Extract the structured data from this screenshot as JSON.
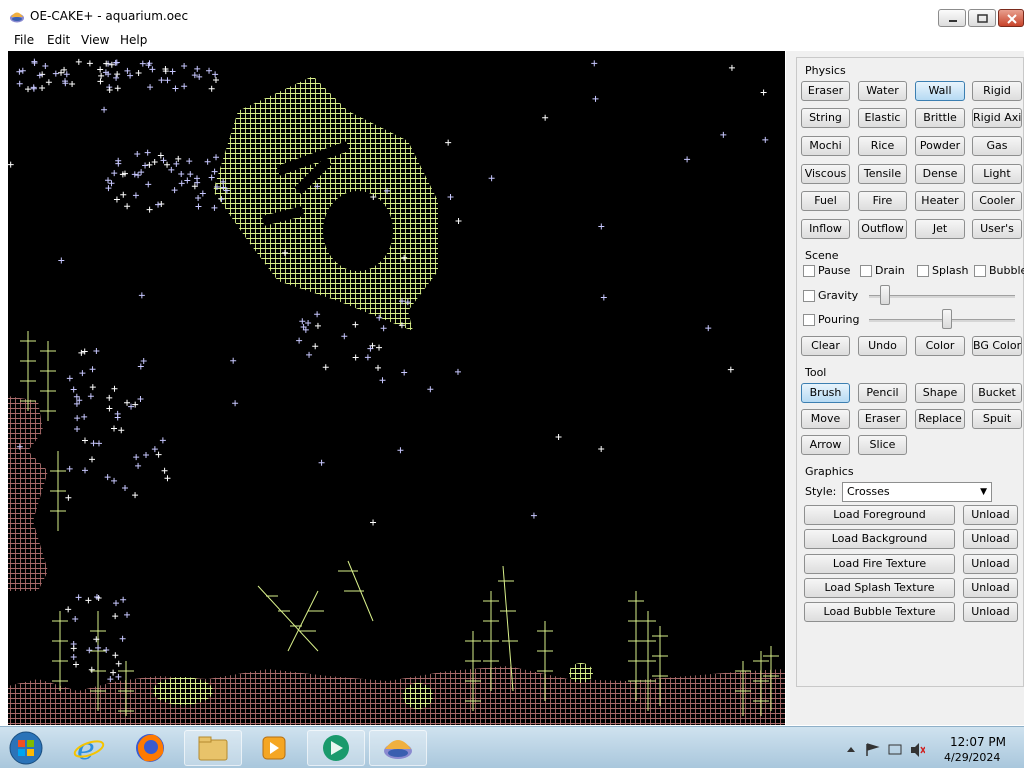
{
  "window": {
    "title": "OE-CAKE+ - aquarium.oec"
  },
  "menu": {
    "file": "File",
    "edit": "Edit",
    "view": "View",
    "help": "Help"
  },
  "physics": {
    "section_label": "Physics",
    "buttons": [
      "Eraser",
      "Water",
      "Wall",
      "Rigid",
      "String",
      "Elastic",
      "Brittle",
      "Rigid Axis",
      "Mochi",
      "Rice",
      "Powder",
      "Gas",
      "Viscous",
      "Tensile",
      "Dense",
      "Light",
      "Fuel",
      "Fire",
      "Heater",
      "Cooler",
      "Inflow",
      "Outflow",
      "Jet",
      "User's"
    ],
    "selected": "Wall"
  },
  "scene": {
    "section_label": "Scene",
    "pause": "Pause",
    "drain": "Drain",
    "splash": "Splash",
    "bubble": "Bubble",
    "gravity": "Gravity",
    "pouring": "Pouring",
    "gravity_level": 0.08,
    "pouring_level": 0.54,
    "clear": "Clear",
    "undo": "Undo",
    "color": "Color",
    "bg_color": "BG Color"
  },
  "tool": {
    "section_label": "Tool",
    "buttons": [
      "Brush",
      "Pencil",
      "Shape",
      "Bucket",
      "Move",
      "Eraser",
      "Replace",
      "Spuit",
      "Arrow",
      "Slice"
    ],
    "selected": "Brush"
  },
  "graphics": {
    "section_label": "Graphics",
    "style_label": "Style:",
    "style_value": "Crosses",
    "loads": [
      "Load Foreground",
      "Load Background",
      "Load Fire Texture",
      "Load Splash Texture",
      "Load Bubble Texture"
    ],
    "unload": "Unload"
  },
  "taskbar": {
    "time": "12:07 PM",
    "date": "4/29/2024"
  },
  "colors": {
    "canvas_bg": "#000000",
    "wall": "#d9f08a",
    "particle": "#c8c8ff",
    "sand": "#b07070",
    "accent": "#3c7fb1"
  }
}
